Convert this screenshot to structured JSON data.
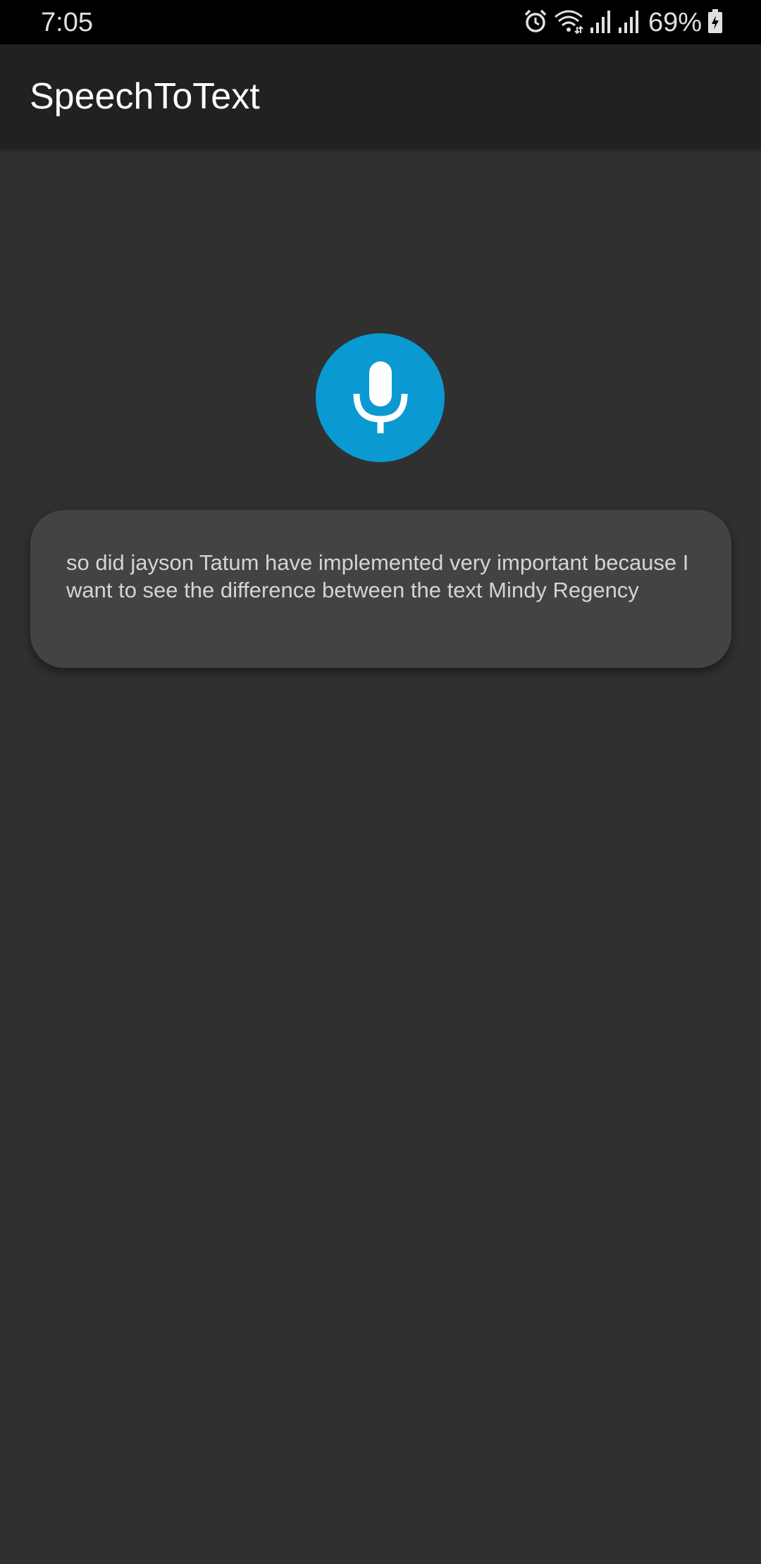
{
  "status_bar": {
    "time": "7:05",
    "battery_percent": "69%",
    "icons": [
      "alarm-icon",
      "wifi-icon",
      "signal-icon",
      "signal-icon",
      "battery-charging-icon"
    ]
  },
  "app_bar": {
    "title": "SpeechToText"
  },
  "mic_button": {
    "icon": "microphone-icon",
    "color": "#0a9ad1"
  },
  "transcript": {
    "text": "so did jayson Tatum have implemented very important because I want to see the difference between the text Mindy Regency"
  },
  "colors": {
    "background": "#303030",
    "app_bar": "#212121",
    "card": "#434343",
    "accent": "#0a9ad1"
  }
}
